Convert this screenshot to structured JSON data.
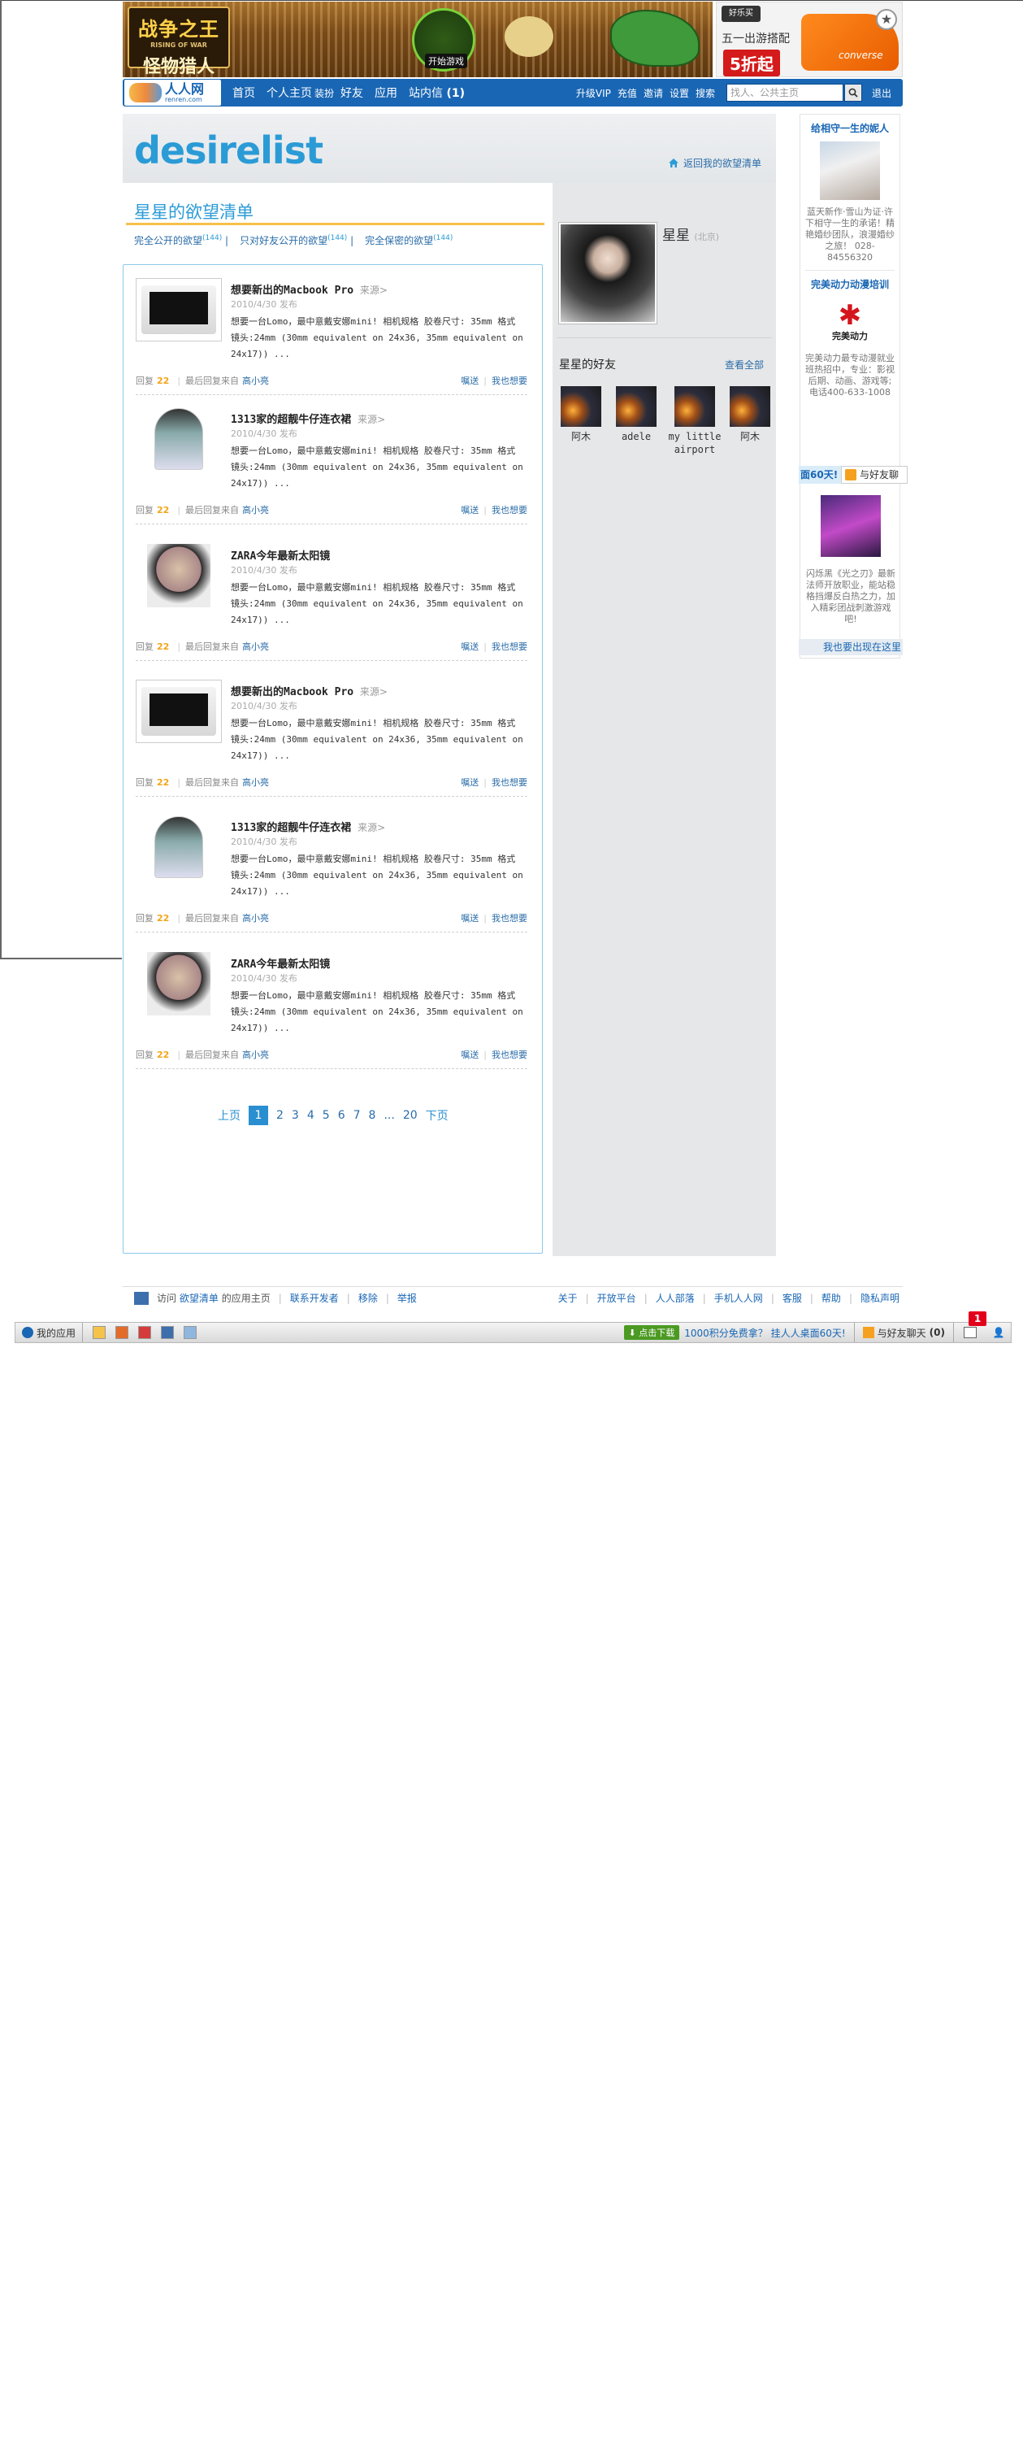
{
  "top_banner": {
    "game_title_line1": "战争之王",
    "game_subtitle": "RISING OF WAR",
    "game_title_line2": "怪物猎人",
    "game_start_label": "开始游戏",
    "shoe_brand": "好乐买",
    "shoe_line": "五一出游搭配",
    "shoe_brand_name": "converse",
    "shoe_discount": "5折起"
  },
  "navbar": {
    "logo_text": "人人网",
    "logo_sub": "renren.com",
    "items": [
      "首页",
      "个人主页",
      "装扮",
      "好友",
      "应用"
    ],
    "inbox_label": "站内信",
    "inbox_count": "(1)",
    "right_items": [
      "升级VIP",
      "充值",
      "邀请",
      "设置",
      "搜索"
    ],
    "search_placeholder": "找人、公共主页",
    "logout_label": "退出"
  },
  "header": {
    "logo": "desirelist",
    "back_link": "返回我的欲望清单"
  },
  "main": {
    "title": "星星的欲望清单",
    "tabs": [
      {
        "label": "完全公开的欲望",
        "count": "(144)"
      },
      {
        "label": "只对好友公开的欲望",
        "count": "(144)"
      },
      {
        "label": "完全保密的欲望",
        "count": "(144)"
      }
    ],
    "items": [
      {
        "title": "想要新出的Macbook Pro",
        "source": "来源>",
        "date": "2010/4/30 发布",
        "desc": "想要一台Lomo，最中意戴安娜mini! 相机规格 胶卷尺寸: 35mm 格式 镜头:24mm (30mm equivalent on 24x36, 35mm equivalent on 24x17)) ...",
        "reply_label": "回复",
        "reply_count": "22",
        "last_reply": "最后回复来自",
        "user": "高小亮",
        "fwd": "嘱送",
        "want": "我也想要",
        "thumb": "laptop"
      },
      {
        "title": "1313家的超靓牛仔连衣裙",
        "source": "来源>",
        "date": "2010/4/30 发布",
        "desc": "想要一台Lomo，最中意戴安娜mini! 相机规格 胶卷尺寸: 35mm 格式 镜头:24mm (30mm equivalent on 24x36, 35mm equivalent on 24x17)) ...",
        "reply_label": "回复",
        "reply_count": "22",
        "last_reply": "最后回复来自",
        "user": "高小亮",
        "fwd": "嘱送",
        "want": "我也想要",
        "thumb": "person"
      },
      {
        "title": "ZARA今年最新太阳镜",
        "source": "",
        "date": "2010/4/30 发布",
        "desc": "想要一台Lomo，最中意戴安娜mini! 相机规格 胶卷尺寸: 35mm 格式 镜头:24mm (30mm equivalent on 24x36, 35mm equivalent on 24x17)) ...",
        "reply_label": "回复",
        "reply_count": "22",
        "last_reply": "最后回复来自",
        "user": "高小亮",
        "fwd": "嘱送",
        "want": "我也想要",
        "thumb": "face"
      },
      {
        "title": "想要新出的Macbook Pro",
        "source": "来源>",
        "date": "2010/4/30 发布",
        "desc": "想要一台Lomo，最中意戴安娜mini! 相机规格 胶卷尺寸: 35mm 格式 镜头:24mm (30mm equivalent on 24x36, 35mm equivalent on 24x17)) ...",
        "reply_label": "回复",
        "reply_count": "22",
        "last_reply": "最后回复来自",
        "user": "高小亮",
        "fwd": "嘱送",
        "want": "我也想要",
        "thumb": "laptop"
      },
      {
        "title": "1313家的超靓牛仔连衣裙",
        "source": "来源>",
        "date": "2010/4/30 发布",
        "desc": "想要一台Lomo，最中意戴安娜mini! 相机规格 胶卷尺寸: 35mm 格式 镜头:24mm (30mm equivalent on 24x36, 35mm equivalent on 24x17)) ...",
        "reply_label": "回复",
        "reply_count": "22",
        "last_reply": "最后回复来自",
        "user": "高小亮",
        "fwd": "嘱送",
        "want": "我也想要",
        "thumb": "person"
      },
      {
        "title": "ZARA今年最新太阳镜",
        "source": "",
        "date": "2010/4/30 发布",
        "desc": "想要一台Lomo，最中意戴安娜mini! 相机规格 胶卷尺寸: 35mm 格式 镜头:24mm (30mm equivalent on 24x36, 35mm equivalent on 24x17)) ...",
        "reply_label": "回复",
        "reply_count": "22",
        "last_reply": "最后回复来自",
        "user": "高小亮",
        "fwd": "嘱送",
        "want": "我也想要",
        "thumb": "face"
      }
    ],
    "pager": {
      "prev": "上页",
      "current": "1",
      "pages": [
        "2",
        "3",
        "4",
        "5",
        "6",
        "7",
        "8"
      ],
      "ellipsis": "...",
      "last": "20",
      "next": "下页"
    }
  },
  "profile": {
    "name": "星星",
    "location": "(北京)",
    "friends_title": "星星的好友",
    "friends_all": "查看全部",
    "friends": [
      "阿木",
      "adele",
      "my little airport",
      "阿木"
    ]
  },
  "ads": {
    "ad1_title": "给相守一生的妮人",
    "ad1_text": "蓝天新作·雪山为证·许下相守一生的承诺！精艳婚纱团队，浪漫婚纱之旅！ 028-84556320",
    "ad2_title": "完美动力动漫培训",
    "ad2_brand": "完美动力",
    "ad2_text": "完美动力最专动漫就业班热招中，专业：影视后期、动画、游戏等;电话400-633-1008",
    "tab_a": "面60天!",
    "tab_b": "与好友聊",
    "ad3_text": "闪烁黑《光之刃》最新法师开放职业，能站稳格挡爆反白热之力，加入精彩团战刺激游戏吧!",
    "bottom_link": "我也要出现在这里"
  },
  "footer": {
    "visit_prefix": "访问",
    "app_name": "欲望清单",
    "visit_suffix": "的应用主页",
    "links_left": [
      "联系开发者",
      "移除",
      "举报"
    ],
    "links_right": [
      "关于",
      "开放平台",
      "人人部落",
      "手机人人网",
      "客服",
      "帮助",
      "隐私声明"
    ]
  },
  "bottom_bar": {
    "my_apps": "我的应用",
    "download_label": "点击下载",
    "promo": "1000积分免费拿？ 挂人人桌面60天!",
    "chat_label": "与好友聊天",
    "chat_count": "(0)",
    "msg_badge": "1"
  }
}
